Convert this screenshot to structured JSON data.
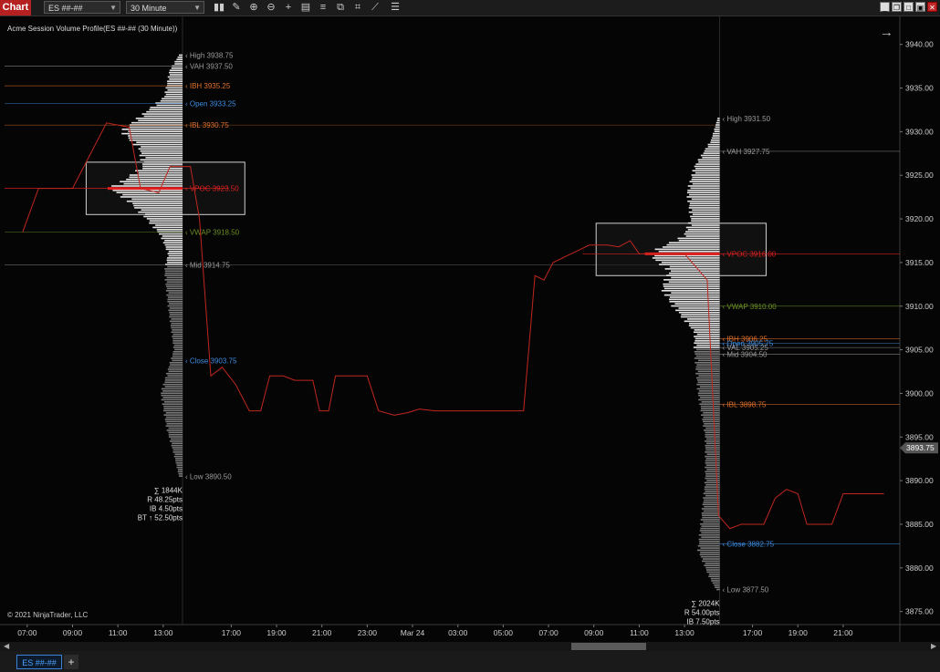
{
  "toolbar": {
    "chart_tab": "Chart",
    "instrument": "ES ##-##",
    "interval": "30 Minute",
    "icons": [
      "bar-type-icon",
      "draw-pencil-icon",
      "zoom-in-icon",
      "zoom-out-icon",
      "crosshair-icon",
      "data-box-icon",
      "properties-icon",
      "strategies-icon",
      "indicators-icon",
      "drawing-tools-icon",
      "templates-icon"
    ],
    "window_buttons": [
      "minimize",
      "restore",
      "maximize",
      "close"
    ]
  },
  "chart": {
    "title": "Acme Session Volume Profile(ES ##-## (30 Minute))",
    "copyright": "© 2021 NinjaTrader, LLC",
    "colors": {
      "price_line": "#c0261f",
      "poc": "#e02020",
      "vwap": "#6b8e23",
      "ib": "#e0702a",
      "open_close": "#3c8be0",
      "label_gray": "#9a9a9a"
    },
    "y_axis": {
      "range": [
        3873.5,
        3943.0
      ],
      "ticks": [
        "3940.00",
        "3935.00",
        "3930.00",
        "3925.00",
        "3920.00",
        "3915.00",
        "3910.00",
        "3905.00",
        "3900.00",
        "3895.00",
        "3890.00",
        "3885.00",
        "3880.00",
        "3875.00"
      ],
      "tick_values": [
        3940,
        3935,
        3930,
        3925,
        3920,
        3915,
        3910,
        3905,
        3900,
        3895,
        3890,
        3885,
        3880,
        3875
      ],
      "last_price_label": "3893.75",
      "last_price": 3893.75
    },
    "x_axis": {
      "ticks": [
        "07:00",
        "09:00",
        "11:00",
        "13:00",
        "17:00",
        "19:00",
        "21:00",
        "23:00",
        "Mar 24",
        "03:00",
        "05:00",
        "07:00",
        "09:00",
        "11:00",
        "13:00",
        "17:00",
        "19:00",
        "21:00"
      ],
      "tick_slots": [
        1,
        3,
        5,
        7,
        10,
        12,
        14,
        16,
        18,
        20,
        22,
        24,
        26,
        28,
        30,
        33,
        35,
        37
      ],
      "slot_count": 39.5
    },
    "price_series": [
      {
        "slot": 0.8,
        "price": 3918.5
      },
      {
        "slot": 1.5,
        "price": 3923.5
      },
      {
        "slot": 3.0,
        "price": 3923.5
      },
      {
        "slot": 4.5,
        "price": 3931.0
      },
      {
        "slot": 5.5,
        "price": 3930.5
      },
      {
        "slot": 6.0,
        "price": 3923.5
      },
      {
        "slot": 6.8,
        "price": 3923.0
      },
      {
        "slot": 7.3,
        "price": 3926.0
      },
      {
        "slot": 8.2,
        "price": 3926.0
      },
      {
        "slot": 8.6,
        "price": 3920.0
      },
      {
        "slot": 9.1,
        "price": 3902.0
      },
      {
        "slot": 9.6,
        "price": 3903.0
      },
      {
        "slot": 10.2,
        "price": 3901.0
      },
      {
        "slot": 10.8,
        "price": 3898.0
      },
      {
        "slot": 11.3,
        "price": 3898.0
      },
      {
        "slot": 11.7,
        "price": 3902.0
      },
      {
        "slot": 12.3,
        "price": 3902.0
      },
      {
        "slot": 12.8,
        "price": 3901.5
      },
      {
        "slot": 13.6,
        "price": 3901.5
      },
      {
        "slot": 13.9,
        "price": 3898.0
      },
      {
        "slot": 14.3,
        "price": 3898.0
      },
      {
        "slot": 14.6,
        "price": 3902.0
      },
      {
        "slot": 15.2,
        "price": 3902.0
      },
      {
        "slot": 16.0,
        "price": 3902.0
      },
      {
        "slot": 16.5,
        "price": 3898.0
      },
      {
        "slot": 17.2,
        "price": 3897.5
      },
      {
        "slot": 17.8,
        "price": 3897.8
      },
      {
        "slot": 18.3,
        "price": 3898.2
      },
      {
        "slot": 19.0,
        "price": 3898.0
      },
      {
        "slot": 20.5,
        "price": 3898.0
      },
      {
        "slot": 22.9,
        "price": 3898.0
      },
      {
        "slot": 23.4,
        "price": 3913.5
      },
      {
        "slot": 23.8,
        "price": 3913.0
      },
      {
        "slot": 24.2,
        "price": 3915.0
      },
      {
        "slot": 25.0,
        "price": 3916.0
      },
      {
        "slot": 25.8,
        "price": 3917.0
      },
      {
        "slot": 26.6,
        "price": 3917.0
      },
      {
        "slot": 27.1,
        "price": 3916.8
      },
      {
        "slot": 27.6,
        "price": 3917.5
      },
      {
        "slot": 28.0,
        "price": 3916.0
      },
      {
        "slot": 29.0,
        "price": 3916.0
      },
      {
        "slot": 30.0,
        "price": 3916.0
      },
      {
        "slot": 31.0,
        "price": 3913.0
      },
      {
        "slot": 31.5,
        "price": 3886.0
      },
      {
        "slot": 32.0,
        "price": 3884.5
      },
      {
        "slot": 32.5,
        "price": 3885.0
      },
      {
        "slot": 33.5,
        "price": 3885.0
      },
      {
        "slot": 34.0,
        "price": 3888.0
      },
      {
        "slot": 34.5,
        "price": 3889.0
      },
      {
        "slot": 35.0,
        "price": 3888.5
      },
      {
        "slot": 35.4,
        "price": 3885.0
      },
      {
        "slot": 36.5,
        "price": 3885.0
      },
      {
        "slot": 37.0,
        "price": 3888.5
      },
      {
        "slot": 38.8,
        "price": 3888.5
      }
    ],
    "profiles": [
      {
        "id": "session-1",
        "edge_slot": 7.85,
        "high": 3938.75,
        "low": 3890.5,
        "poc": 3923.5,
        "value_area_low": 3914.75,
        "value_area_box": {
          "slot_start": 3.6,
          "slot_end": 10.6,
          "price_top": 3926.5,
          "price_bottom": 3920.5
        },
        "levels": [
          {
            "name": "high",
            "label": "High 3938.75",
            "price": 3938.75,
            "color": "#9a9a9a",
            "line": false
          },
          {
            "name": "vah",
            "label": "VAH 3937.50",
            "price": 3937.5,
            "color": "#9a9a9a",
            "line": true
          },
          {
            "name": "ibh",
            "label": "IBH 3935.25",
            "price": 3935.25,
            "color": "#e0702a",
            "line": true
          },
          {
            "name": "open",
            "label": "Open 3933.25",
            "price": 3933.25,
            "color": "#3c8be0",
            "line": true
          },
          {
            "name": "ibl",
            "label": "IBL 3930.75",
            "price": 3930.75,
            "color": "#e0702a",
            "line": true
          },
          {
            "name": "vpoc",
            "label": "VPOC 3923.50",
            "price": 3923.5,
            "color": "#e02020",
            "line": true
          },
          {
            "name": "vwap",
            "label": "VWAP 3918.50",
            "price": 3918.5,
            "color": "#6b8e23",
            "line": true
          },
          {
            "name": "mid",
            "label": "Mid 3914.75",
            "price": 3914.75,
            "color": "#9a9a9a",
            "line": true
          },
          {
            "name": "close",
            "label": "Close 3903.75",
            "price": 3903.75,
            "color": "#3c8be0",
            "line": false
          },
          {
            "name": "low",
            "label": "Low 3890.50",
            "price": 3890.5,
            "color": "#9a9a9a",
            "line": false
          }
        ],
        "stats": [
          "∑ 1844K",
          "R 48.25pts",
          "IB 4.50pts",
          "BT ↑ 52.50pts"
        ],
        "volume_shape": [
          {
            "price": 3938.75,
            "width": 0.05
          },
          {
            "price": 3937.0,
            "width": 0.18
          },
          {
            "price": 3934.0,
            "width": 0.25
          },
          {
            "price": 3932.0,
            "width": 0.55
          },
          {
            "price": 3930.0,
            "width": 0.85
          },
          {
            "price": 3928.0,
            "width": 0.6
          },
          {
            "price": 3926.0,
            "width": 0.55
          },
          {
            "price": 3924.5,
            "width": 0.8
          },
          {
            "price": 3923.5,
            "width": 1.0
          },
          {
            "price": 3922.0,
            "width": 0.75
          },
          {
            "price": 3920.0,
            "width": 0.5
          },
          {
            "price": 3918.0,
            "width": 0.3
          },
          {
            "price": 3916.0,
            "width": 0.2
          },
          {
            "price": 3914.0,
            "width": 0.25
          },
          {
            "price": 3910.0,
            "width": 0.2
          },
          {
            "price": 3905.0,
            "width": 0.12
          },
          {
            "price": 3900.0,
            "width": 0.3
          },
          {
            "price": 3896.0,
            "width": 0.22
          },
          {
            "price": 3893.0,
            "width": 0.12
          },
          {
            "price": 3890.5,
            "width": 0.05
          }
        ]
      },
      {
        "id": "session-2",
        "edge_slot": 31.55,
        "high": 3931.5,
        "low": 3877.5,
        "poc": 3916.0,
        "value_area_low": 3905.25,
        "value_area_box": {
          "slot_start": 26.1,
          "slot_end": 33.6,
          "price_top": 3919.5,
          "price_bottom": 3913.5
        },
        "levels": [
          {
            "name": "high",
            "label": "High 3931.50",
            "price": 3931.5,
            "color": "#9a9a9a",
            "line": false
          },
          {
            "name": "vah",
            "label": "VAH 3927.75",
            "price": 3927.75,
            "color": "#9a9a9a",
            "line": true
          },
          {
            "name": "vpoc",
            "label": "VPOC 3916.00",
            "price": 3916.0,
            "color": "#e02020",
            "line": true
          },
          {
            "name": "vwap",
            "label": "VWAP 3910.00",
            "price": 3910.0,
            "color": "#6b8e23",
            "line": true
          },
          {
            "name": "ibh",
            "label": "IBH 3906.25",
            "price": 3906.25,
            "color": "#e0702a",
            "line": true
          },
          {
            "name": "open",
            "label": "Open 3905.75",
            "price": 3905.75,
            "color": "#3c8be0",
            "line": true
          },
          {
            "name": "val",
            "label": "VAL 3905.25",
            "price": 3905.25,
            "color": "#9a9a9a",
            "line": true
          },
          {
            "name": "mid",
            "label": "Mid 3904.50",
            "price": 3904.5,
            "color": "#9a9a9a",
            "line": true
          },
          {
            "name": "ibl",
            "label": "IBL 3898.75",
            "price": 3898.75,
            "color": "#e0702a",
            "line": true
          },
          {
            "name": "close",
            "label": "Close 3882.75",
            "price": 3882.75,
            "color": "#3c8be0",
            "line": true
          },
          {
            "name": "low",
            "label": "Low 3877.50",
            "price": 3877.5,
            "color": "#9a9a9a",
            "line": false
          }
        ],
        "stats": [
          "∑ 2024K",
          "R 54.00pts",
          "IB 7.50pts"
        ],
        "volume_shape": [
          {
            "price": 3931.5,
            "width": 0.03
          },
          {
            "price": 3929.0,
            "width": 0.12
          },
          {
            "price": 3926.0,
            "width": 0.35
          },
          {
            "price": 3923.0,
            "width": 0.45
          },
          {
            "price": 3920.0,
            "width": 0.4
          },
          {
            "price": 3918.0,
            "width": 0.5
          },
          {
            "price": 3916.0,
            "width": 1.0
          },
          {
            "price": 3914.0,
            "width": 0.7
          },
          {
            "price": 3912.0,
            "width": 0.8
          },
          {
            "price": 3910.0,
            "width": 0.65
          },
          {
            "price": 3907.0,
            "width": 0.35
          },
          {
            "price": 3905.0,
            "width": 0.35
          },
          {
            "price": 3900.0,
            "width": 0.3
          },
          {
            "price": 3895.0,
            "width": 0.2
          },
          {
            "price": 3890.0,
            "width": 0.2
          },
          {
            "price": 3886.0,
            "width": 0.25
          },
          {
            "price": 3882.0,
            "width": 0.3
          },
          {
            "price": 3879.0,
            "width": 0.15
          },
          {
            "price": 3877.5,
            "width": 0.05
          }
        ]
      }
    ]
  },
  "tabs": [
    {
      "label": "ES ##-##"
    }
  ],
  "add_tab": "+"
}
